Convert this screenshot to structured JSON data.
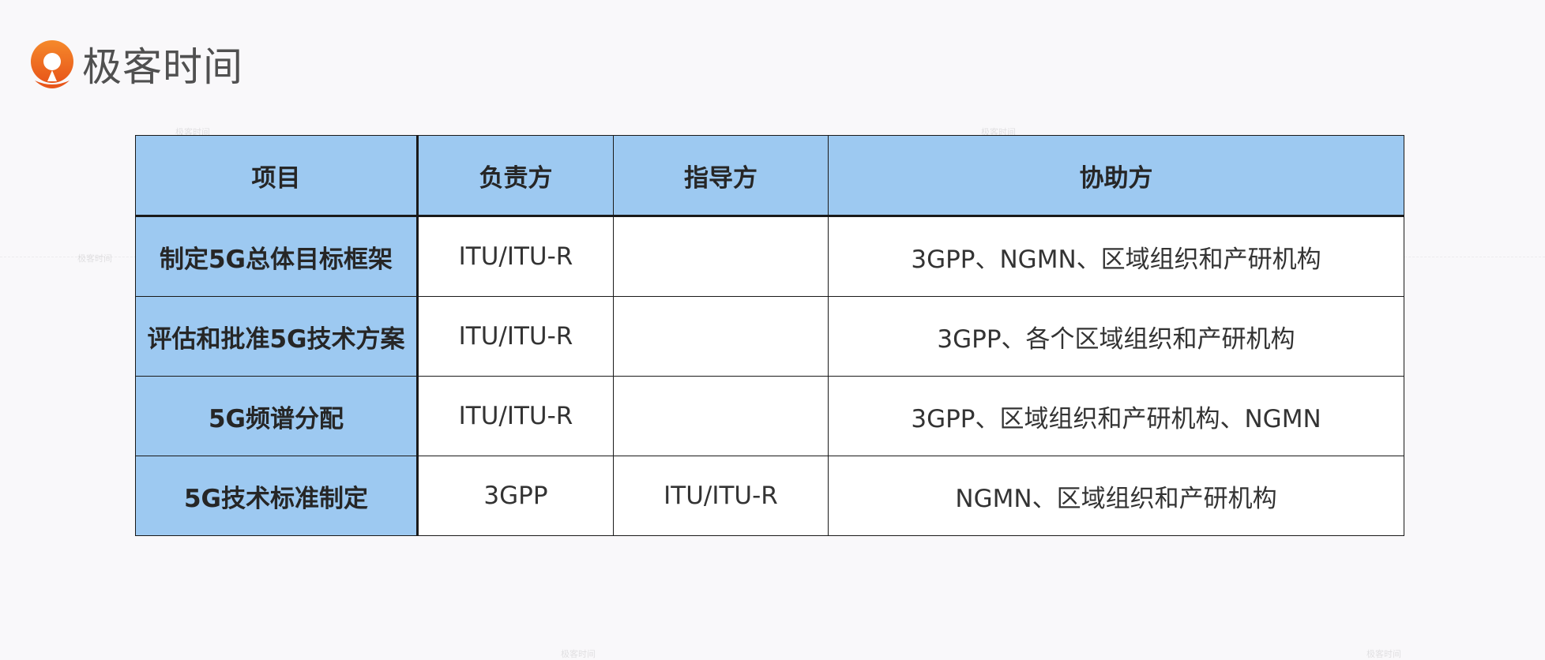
{
  "brand": {
    "name": "极客时间",
    "accent_color": "#f06a1f",
    "icon": "geektime-logo-icon"
  },
  "watermark_text": "极客时间",
  "table": {
    "header_color": "#9dc9f1",
    "headers": [
      "项目",
      "负责方",
      "指导方",
      "协助方"
    ],
    "rows": [
      {
        "item": "制定5G总体目标框架",
        "owner": "ITU/ITU-R",
        "guide": "",
        "assist": "3GPP、NGMN、区域组织和产研机构"
      },
      {
        "item": "评估和批准5G技术方案",
        "owner": "ITU/ITU-R",
        "guide": "",
        "assist": "3GPP、各个区域组织和产研机构"
      },
      {
        "item": "5G频谱分配",
        "owner": "ITU/ITU-R",
        "guide": "",
        "assist": "3GPP、区域组织和产研机构、NGMN"
      },
      {
        "item": "5G技术标准制定",
        "owner": "3GPP",
        "guide": "ITU/ITU-R",
        "assist": "NGMN、区域组织和产研机构"
      }
    ]
  }
}
